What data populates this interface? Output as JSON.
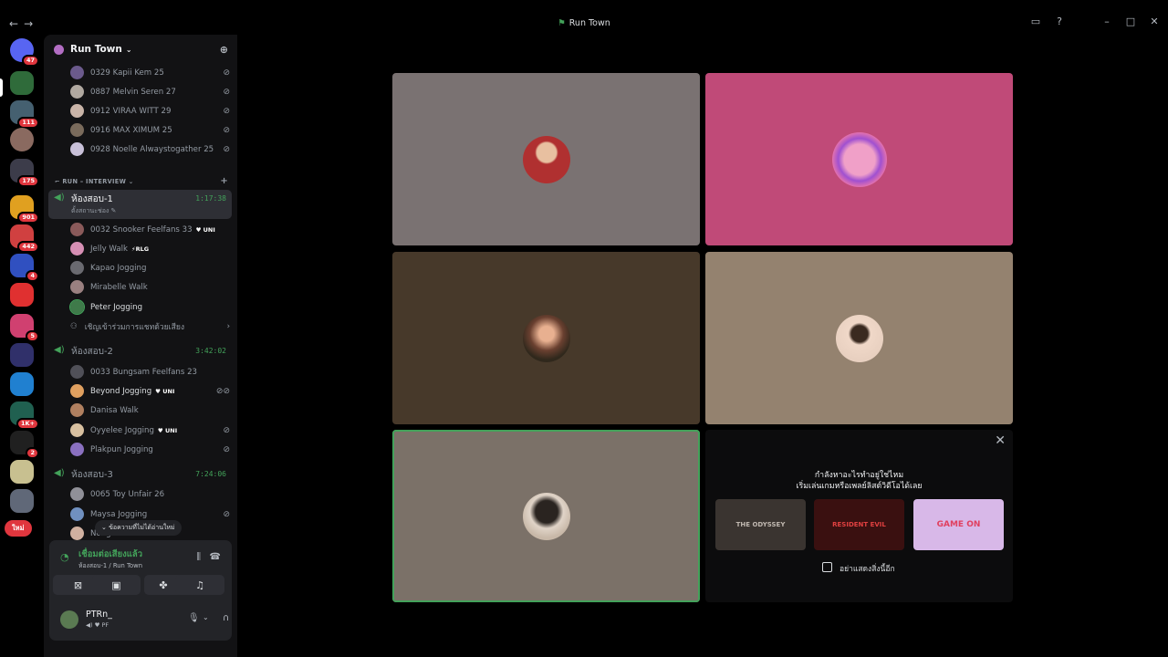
{
  "window": {
    "title": "Run Town",
    "nav_back": "←",
    "nav_fwd": "→"
  },
  "server_rail": {
    "badges": [
      "47",
      "111",
      "175",
      "901",
      "442",
      "4",
      "5",
      "1K+",
      "2"
    ],
    "new_label": "ใหม่"
  },
  "server": {
    "name": "Run Town"
  },
  "top_members": [
    {
      "name": "0329 Kapii Kem 25",
      "color": "#6b5a8c"
    },
    {
      "name": "0887 Melvin Seren 27",
      "color": "#b0a8a0"
    },
    {
      "name": "0912 VIRAA WITT 29",
      "color": "#c9b4a8"
    },
    {
      "name": "0916 MAX XIMUM 25",
      "color": "#7a6b5c"
    },
    {
      "name": "0928 Noelle Alwaystogather 25",
      "color": "#c8c0d8"
    }
  ],
  "category": {
    "name": "RUN – INTERVIEW"
  },
  "voice_channels": [
    {
      "name": "ห้องสอบ-1",
      "timer": "1:17:38",
      "status": "ตั้งสถานะช่อง",
      "members": [
        {
          "name": "0032 Snooker Feelfans 33",
          "tag": "UNI",
          "color": "#8a5a5a"
        },
        {
          "name": "Jelly Walk",
          "tag": "RLG",
          "color": "#d68fb4"
        },
        {
          "name": "Kapao Jogging",
          "tag": "",
          "color": "#6a6a70"
        },
        {
          "name": "Mirabelle Walk",
          "tag": "",
          "color": "#9a8080"
        },
        {
          "name": "Peter Jogging",
          "tag": "",
          "color": "#3f7a4a"
        }
      ],
      "invite": "เชิญเข้าร่วมการแชทด้วยเสียง"
    },
    {
      "name": "ห้องสอบ-2",
      "timer": "3:42:02",
      "members": [
        {
          "name": "0033 Bungsam Feelfans 23",
          "tag": "",
          "color": "#505058"
        },
        {
          "name": "Beyond Jogging",
          "tag": "UNI",
          "color": "#e0a060"
        },
        {
          "name": "Danisa Walk",
          "tag": "",
          "color": "#b08060"
        },
        {
          "name": "Oyyelee Jogging",
          "tag": "UNI",
          "color": "#d8c0a0"
        },
        {
          "name": "Plakpun Jogging",
          "tag": "",
          "color": "#8a70c0"
        }
      ]
    },
    {
      "name": "ห้องสอบ-3",
      "timer": "7:24:06",
      "members": [
        {
          "name": "0065 Toy Unfair 26",
          "tag": "",
          "color": "#909098"
        },
        {
          "name": "Maysa Jogging",
          "tag": "",
          "color": "#7090c0"
        },
        {
          "name": "Nongboat Walk",
          "tag": "",
          "color": "#d0b0a0"
        }
      ]
    }
  ],
  "new_messages": "ข้อความที่ไม่ได้อ่านใหม่",
  "voice_panel": {
    "connected": "เชื่อมต่อเสียงแล้ว",
    "location": "ห้องสอบ-1 / Run Town"
  },
  "me": {
    "name": "PTRn_",
    "status": "PF"
  },
  "tiles": [
    {
      "bg": "#7a7272",
      "avatar": "#b03030"
    },
    {
      "bg": "#c04a78",
      "avatar": "#e070b0"
    },
    {
      "bg": "#47392a",
      "avatar": "#c07050"
    },
    {
      "bg": "#94826f",
      "avatar": "#e8d0c0"
    },
    {
      "bg": "#7b7168",
      "avatar": "#d8ccc0"
    }
  ],
  "promo": {
    "line1": "กำลังหาอะไรทำอยู่ใช่ไหม",
    "line2": "เริ่มเล่นเกมหรือเพลย์ลิสต์วิดีโอได้เลย",
    "games": [
      {
        "label": "THE ODYSSEY",
        "bg": "#3a3430",
        "fg": "#c0b8b0"
      },
      {
        "label": "RESIDENT EVIL",
        "bg": "#3a1010",
        "fg": "#e04040"
      },
      {
        "label": "GAME ON",
        "bg": "#d8b8e8",
        "fg": "#e04060"
      }
    ],
    "dont_show": "อย่าแสดงสิ่งนี้อีก"
  },
  "colors": {
    "accent_green": "#43a25a",
    "badge_red": "#e0363e"
  }
}
